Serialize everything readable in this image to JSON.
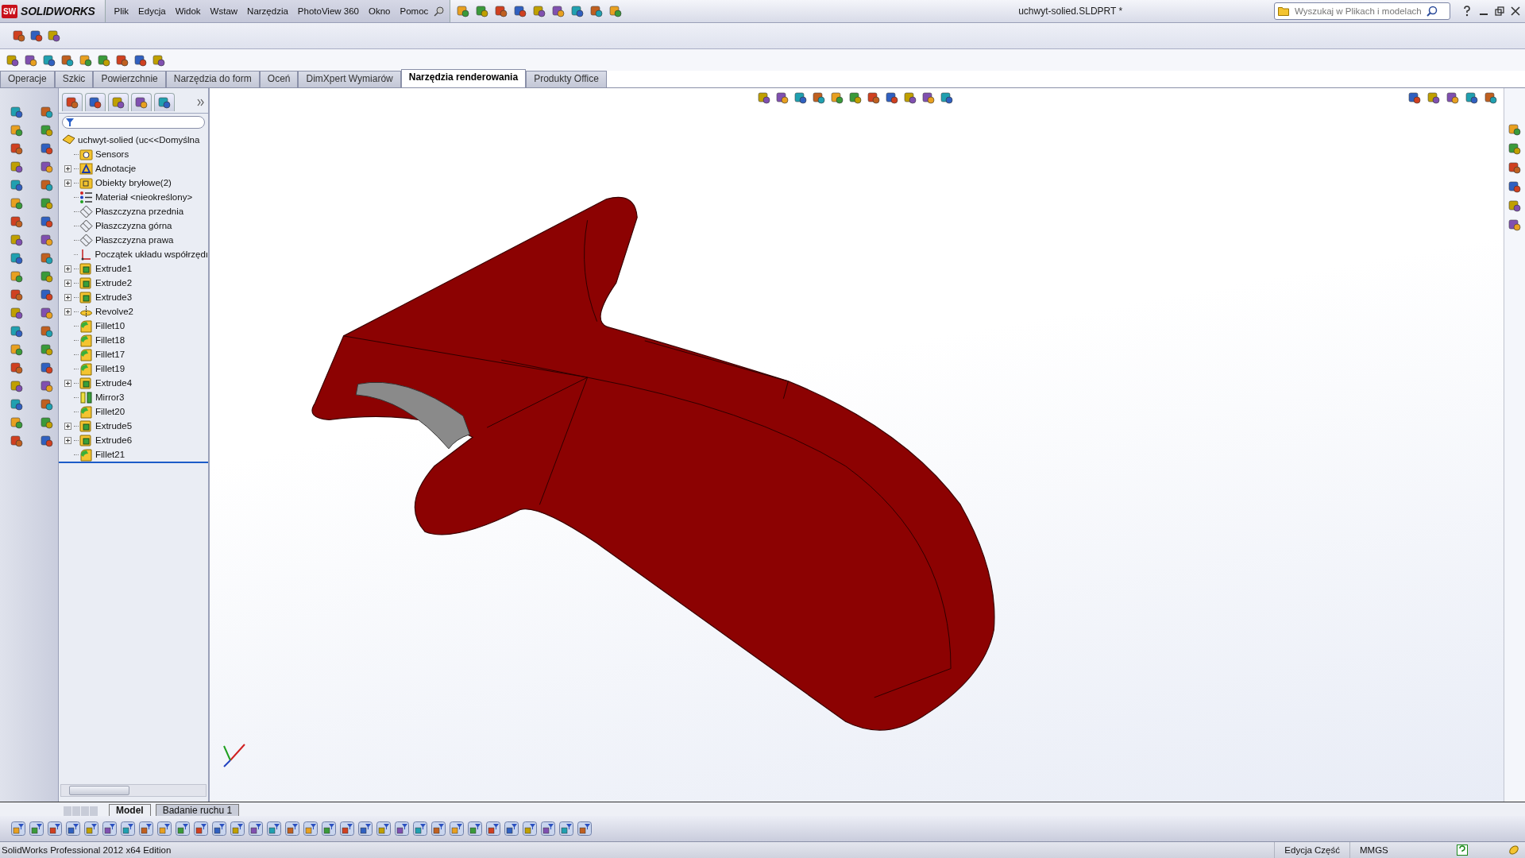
{
  "app": {
    "logo_mark": "SW",
    "logo": "SOLIDWORKS",
    "menu": [
      "Plik",
      "Edycja",
      "Widok",
      "Wstaw",
      "Narzędzia",
      "PhotoView 360",
      "Okno",
      "Pomoc"
    ],
    "title": "uchwyt-solied.SLDPRT *",
    "search": {
      "placeholder": "Wyszukaj w Plikach i modelach"
    }
  },
  "command_tabs": [
    {
      "label": "Operacje",
      "selected": false
    },
    {
      "label": "Szkic",
      "selected": false
    },
    {
      "label": "Powierzchnie",
      "selected": false
    },
    {
      "label": "Narzędzia do form",
      "selected": false
    },
    {
      "label": "Oceń",
      "selected": false
    },
    {
      "label": "DimXpert Wymiarów",
      "selected": false
    },
    {
      "label": "Narzędzia renderowania",
      "selected": true
    },
    {
      "label": "Produkty Office",
      "selected": false
    }
  ],
  "feature_tree": {
    "root": "uchwyt-solied  (uc<<Domyślna",
    "children": [
      {
        "label": "Sensors",
        "kind": "sensors",
        "expandable": false
      },
      {
        "label": "Adnotacje",
        "kind": "annotations",
        "expandable": true
      },
      {
        "label": "Obiekty bryłowe(2)",
        "kind": "bodies",
        "expandable": true
      },
      {
        "label": "Materiał <nieokreślony>",
        "kind": "material",
        "expandable": false
      },
      {
        "label": "Płaszczyzna przednia",
        "kind": "plane",
        "expandable": false
      },
      {
        "label": "Płaszczyzna górna",
        "kind": "plane",
        "expandable": false
      },
      {
        "label": "Płaszczyzna prawa",
        "kind": "plane",
        "expandable": false
      },
      {
        "label": "Początek układu współrzędı",
        "kind": "origin",
        "expandable": false
      },
      {
        "label": "Extrude1",
        "kind": "extrude",
        "expandable": true
      },
      {
        "label": "Extrude2",
        "kind": "extrude",
        "expandable": true
      },
      {
        "label": "Extrude3",
        "kind": "extrude",
        "expandable": true
      },
      {
        "label": "Revolve2",
        "kind": "revolve",
        "expandable": true
      },
      {
        "label": "Fillet10",
        "kind": "fillet",
        "expandable": false
      },
      {
        "label": "Fillet18",
        "kind": "fillet",
        "expandable": false
      },
      {
        "label": "Fillet17",
        "kind": "fillet",
        "expandable": false
      },
      {
        "label": "Fillet19",
        "kind": "fillet",
        "expandable": false
      },
      {
        "label": "Extrude4",
        "kind": "extrude",
        "expandable": true
      },
      {
        "label": "Mirror3",
        "kind": "mirror",
        "expandable": false
      },
      {
        "label": "Fillet20",
        "kind": "fillet",
        "expandable": false
      },
      {
        "label": "Extrude5",
        "kind": "extrude",
        "expandable": true
      },
      {
        "label": "Extrude6",
        "kind": "extrude",
        "expandable": true
      },
      {
        "label": "Fillet21",
        "kind": "fillet",
        "expandable": false
      }
    ]
  },
  "bottom_tabs": [
    {
      "label": "Model",
      "selected": true
    },
    {
      "label": "Badanie ruchu 1",
      "selected": false
    }
  ],
  "status_bar": {
    "edition": "SolidWorks Professional 2012 x64 Edition",
    "mode": "Edycja Część",
    "units": "MMGS"
  }
}
